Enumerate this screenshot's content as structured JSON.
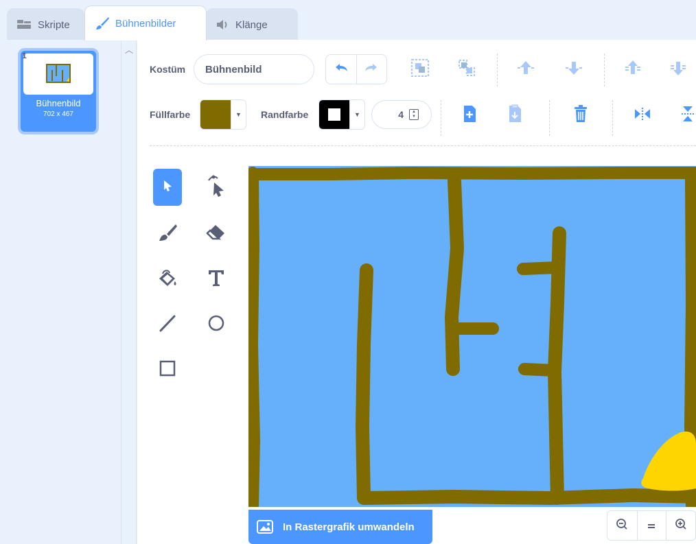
{
  "tabs": [
    {
      "label": "Skripte",
      "icon": "code-icon"
    },
    {
      "label": "Bühnenbilder",
      "icon": "paintbrush-icon"
    },
    {
      "label": "Klänge",
      "icon": "sound-icon"
    }
  ],
  "costume": {
    "number": "1",
    "name": "Bühnenbild",
    "size": "702 x 467"
  },
  "toolbar": {
    "costume_label": "Kostüm",
    "costume_name": "Bühnenbild",
    "fill_label": "Füllfarbe",
    "outline_label": "Randfarbe",
    "stroke_width": "4"
  },
  "colors": {
    "fill": "#7f6b00",
    "outline": "#000000",
    "canvas_blue": "#66b0fa",
    "stroke_brown": "#7f6b00",
    "yellow": "#ffd500",
    "accent": "#4c97ff"
  },
  "convert_button": {
    "label": "In Rastergrafik umwandeln"
  },
  "zoom": {
    "out": "−",
    "reset": "=",
    "in": "+"
  }
}
